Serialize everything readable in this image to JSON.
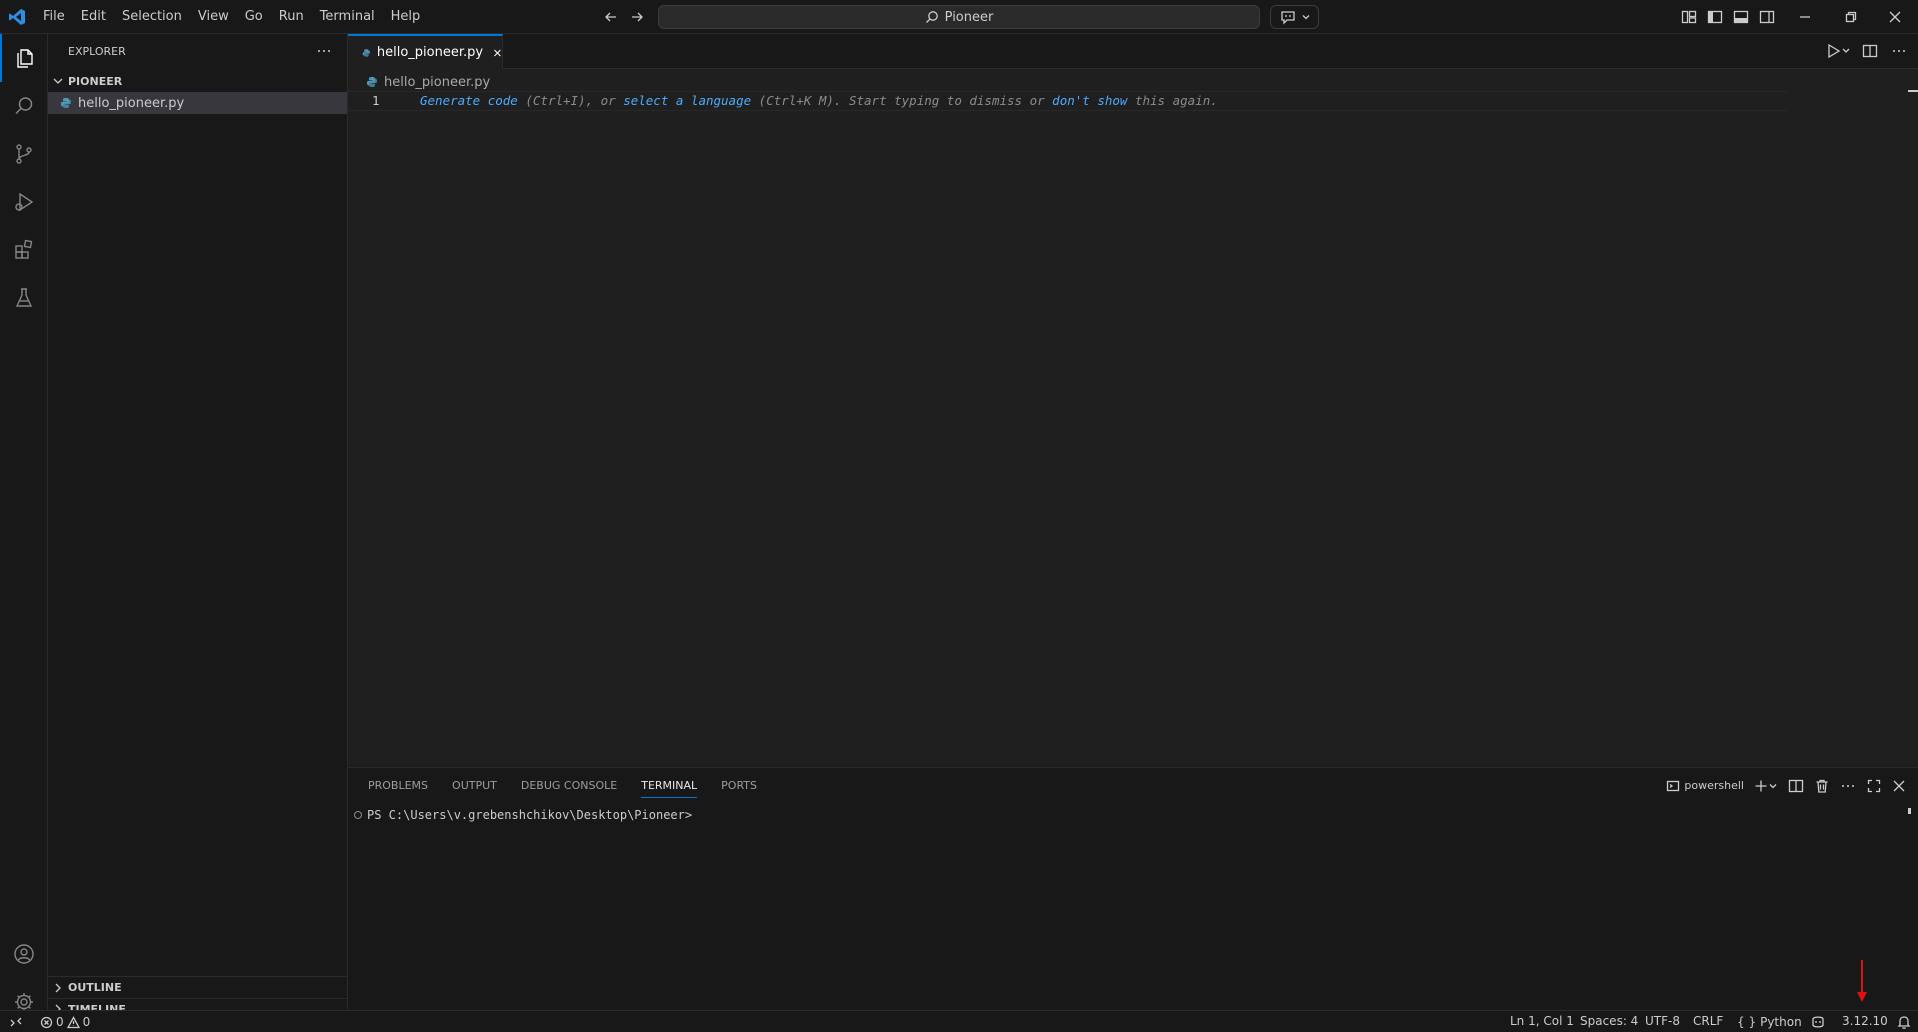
{
  "menu": [
    "File",
    "Edit",
    "Selection",
    "View",
    "Go",
    "Run",
    "Terminal",
    "Help"
  ],
  "search": {
    "text": "Pioneer"
  },
  "sidebar": {
    "title": "EXPLORER",
    "folder": "PIONEER",
    "file": "hello_pioneer.py",
    "outline": "OUTLINE",
    "timeline": "TIMELINE"
  },
  "editor": {
    "tab_label": "hello_pioneer.py",
    "breadcrumb": "hello_pioneer.py",
    "line_number": "1",
    "hint": {
      "link1": "Generate code",
      "text1": " (Ctrl+I), or ",
      "link2": "select a language",
      "text2": " (Ctrl+K M). Start typing to dismiss or ",
      "link3": "don't show",
      "text3": " this again."
    }
  },
  "panel": {
    "tabs": [
      "PROBLEMS",
      "OUTPUT",
      "DEBUG CONSOLE",
      "TERMINAL",
      "PORTS"
    ],
    "active_tab": "TERMINAL",
    "terminal_name": "powershell",
    "prompt": "PS C:\\Users\\v.grebenshchikov\\Desktop\\Pioneer>"
  },
  "status": {
    "errors": "0",
    "warnings": "0",
    "cursor": "Ln 1, Col 1",
    "spaces": "Spaces: 4",
    "encoding": "UTF-8",
    "eol": "CRLF",
    "language": "Python",
    "interpreter": "3.12.10"
  },
  "colors": {
    "accent": "#0078d4",
    "link": "#4daafc",
    "annotation_arrow": "#e01010",
    "python_icon": "#519aba"
  }
}
